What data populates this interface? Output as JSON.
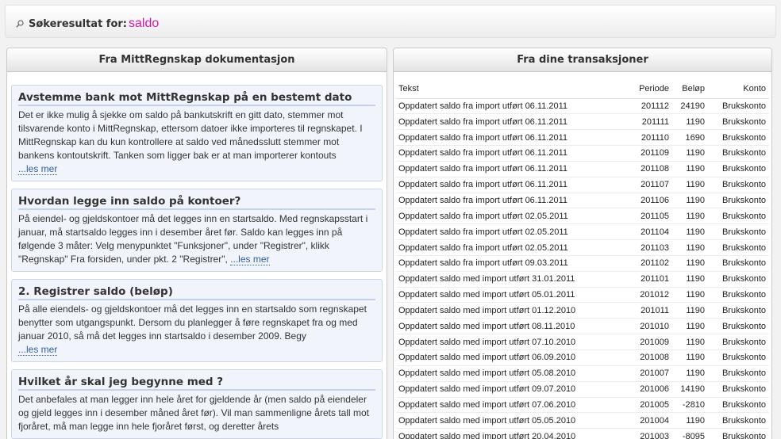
{
  "header": {
    "label": "Søkeresultat for:",
    "term": "saldo"
  },
  "left_panel": {
    "title": "Fra MittRegnskap dokumentasjon",
    "articles": [
      {
        "title": "Avstemme bank mot MittRegnskap på en bestemt dato",
        "excerpt": "Det er ikke mulig å sjekke om saldo på bankutskrift en gitt dato, stemmer mot tilsvarende konto i MittRegnskap, ettersom datoer ikke importeres til regnskapet. I MittRegnskap kan du kun kontrollere at saldo ved månedsslutt stemmer mot bankens kontoutskrift.  Tanken som ligger bak er at man importerer kontouts",
        "more": "...les mer"
      },
      {
        "title": "Hvordan legge inn saldo på kontoer?",
        "excerpt": "På eiendel- og gjeldskontoer må det legges inn en startsaldo. Med regnskapsstart i januar, må startsaldo legges inn i desember året før. Saldo kan legges inn på følgende 3 måter: Velg menypunktet \"Funksjoner\", under \"Registrer\", klikk \"Regnskap\" Fra forsiden, under pkt. 2 \"Registrer\", ",
        "more": "...les mer"
      },
      {
        "title": "2. Registrer saldo (beløp)",
        "excerpt": "På alle eiendels- og gjeldskontoer må det legges inn en startsaldo som regnskapet benytter som utgangspunkt. Dersom du planlegger å føre regnskapet fra og med januar 2010, så må det legges inn startsaldo i desember 2009. Begy",
        "more": "...les mer"
      },
      {
        "title": "Hvilket år skal jeg begynne med ?",
        "excerpt": "Det anbefales at man legger inn hele året for gjeldende år (men saldo på eiendeler og gjeld legges inn i desember måned året før). Vil man sammenligne årets tall mot fjoråret, må man legge inn hele fjoråret først, og deretter årets",
        "more": ""
      }
    ]
  },
  "right_panel": {
    "title": "Fra dine transaksjoner",
    "columns": {
      "text": "Tekst",
      "periode": "Periode",
      "belop": "Beløp",
      "konto": "Konto"
    },
    "rows": [
      {
        "text": "Oppdatert saldo fra import utført 06.11.2011",
        "periode": "201112",
        "belop": "24190",
        "konto": "Brukskonto"
      },
      {
        "text": "Oppdatert saldo fra import utført 06.11.2011",
        "periode": "201111",
        "belop": "1190",
        "konto": "Brukskonto"
      },
      {
        "text": "Oppdatert saldo fra import utført 06.11.2011",
        "periode": "201110",
        "belop": "1690",
        "konto": "Brukskonto"
      },
      {
        "text": "Oppdatert saldo fra import utført 06.11.2011",
        "periode": "201109",
        "belop": "1190",
        "konto": "Brukskonto"
      },
      {
        "text": "Oppdatert saldo fra import utført 06.11.2011",
        "periode": "201108",
        "belop": "1190",
        "konto": "Brukskonto"
      },
      {
        "text": "Oppdatert saldo fra import utført 06.11.2011",
        "periode": "201107",
        "belop": "1190",
        "konto": "Brukskonto"
      },
      {
        "text": "Oppdatert saldo fra import utført 06.11.2011",
        "periode": "201106",
        "belop": "1190",
        "konto": "Brukskonto"
      },
      {
        "text": "Oppdatert saldo fra import utført 02.05.2011",
        "periode": "201105",
        "belop": "1190",
        "konto": "Brukskonto"
      },
      {
        "text": "Oppdatert saldo fra import utført 02.05.2011",
        "periode": "201104",
        "belop": "1190",
        "konto": "Brukskonto"
      },
      {
        "text": "Oppdatert saldo fra import utført 02.05.2011",
        "periode": "201103",
        "belop": "1190",
        "konto": "Brukskonto"
      },
      {
        "text": "Oppdatert saldo fra import utført 09.03.2011",
        "periode": "201102",
        "belop": "1190",
        "konto": "Brukskonto"
      },
      {
        "text": "Oppdatert saldo med import utført 31.01.2011",
        "periode": "201101",
        "belop": "1190",
        "konto": "Brukskonto"
      },
      {
        "text": "Oppdatert saldo med import utført 05.01.2011",
        "periode": "201012",
        "belop": "1190",
        "konto": "Brukskonto"
      },
      {
        "text": "Oppdatert saldo med import utført 01.12.2010",
        "periode": "201011",
        "belop": "1190",
        "konto": "Brukskonto"
      },
      {
        "text": "Oppdatert saldo med import utført 08.11.2010",
        "periode": "201010",
        "belop": "1190",
        "konto": "Brukskonto"
      },
      {
        "text": "Oppdatert saldo med import utført 07.10.2010",
        "periode": "201009",
        "belop": "1190",
        "konto": "Brukskonto"
      },
      {
        "text": "Oppdatert saldo med import utført 06.09.2010",
        "periode": "201008",
        "belop": "1190",
        "konto": "Brukskonto"
      },
      {
        "text": "Oppdatert saldo med import utført 05.08.2010",
        "periode": "201007",
        "belop": "1190",
        "konto": "Brukskonto"
      },
      {
        "text": "Oppdatert saldo med import utført 09.07.2010",
        "periode": "201006",
        "belop": "14190",
        "konto": "Brukskonto"
      },
      {
        "text": "Oppdatert saldo med import utført 07.06.2010",
        "periode": "201005",
        "belop": "-2810",
        "konto": "Brukskonto"
      },
      {
        "text": "Oppdatert saldo med import utført 05.05.2010",
        "periode": "201004",
        "belop": "1190",
        "konto": "Brukskonto"
      },
      {
        "text": "Oppdatert saldo med import utført 20.04.2010",
        "periode": "201003",
        "belop": "-8095",
        "konto": "Brukskonto"
      }
    ]
  }
}
